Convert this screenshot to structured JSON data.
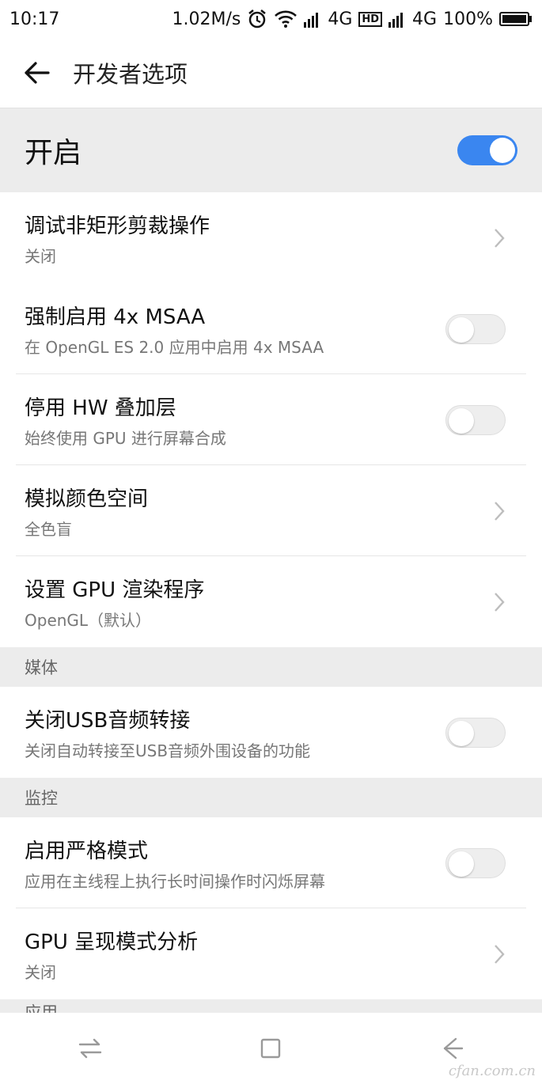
{
  "status_bar": {
    "time": "10:17",
    "speed": "1.02M/s",
    "net1": "4G",
    "hd": "HD",
    "net2": "4G",
    "battery": "100%",
    "icons": [
      "alarm-icon",
      "wifi-icon",
      "signal-icon",
      "battery-icon"
    ]
  },
  "header": {
    "title": "开发者选项",
    "back_icon": "arrow-left-icon"
  },
  "master_switch": {
    "label": "开启",
    "on": true,
    "accent": "#3a86f0"
  },
  "rows": [
    {
      "title": "调试非矩形剪裁操作",
      "subtitle": "关闭",
      "control": "chevron"
    },
    {
      "title": "强制启用 4x MSAA",
      "subtitle": "在 OpenGL ES 2.0 应用中启用 4x MSAA",
      "control": "toggle",
      "on": false
    },
    {
      "title": "停用 HW 叠加层",
      "subtitle": "始终使用 GPU 进行屏幕合成",
      "control": "toggle",
      "on": false
    },
    {
      "title": "模拟颜色空间",
      "subtitle": "全色盲",
      "control": "chevron"
    },
    {
      "title": "设置 GPU 渲染程序",
      "subtitle": "OpenGL（默认）",
      "control": "chevron"
    }
  ],
  "sections": {
    "media": {
      "label": "媒体",
      "rows": [
        {
          "title": "关闭USB音频转接",
          "subtitle": "关闭自动转接至USB音频外围设备的功能",
          "control": "toggle",
          "on": false
        }
      ]
    },
    "monitoring": {
      "label": "监控",
      "rows": [
        {
          "title": "启用严格模式",
          "subtitle": "应用在主线程上执行长时间操作时闪烁屏幕",
          "control": "toggle",
          "on": false
        },
        {
          "title": "GPU 呈现模式分析",
          "subtitle": "关闭",
          "control": "chevron"
        }
      ]
    },
    "apps": {
      "label": "应用"
    }
  },
  "nav_bar": {
    "icons": [
      "switch-apps-icon",
      "home-square-icon",
      "back-arrow-icon"
    ]
  },
  "watermark": "cfan.com.cn"
}
